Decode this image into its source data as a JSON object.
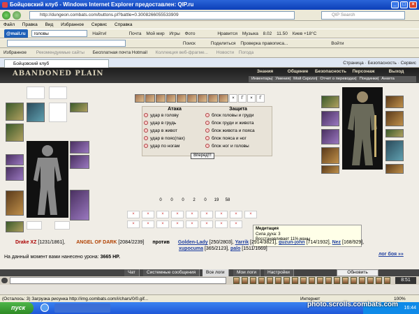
{
  "window": {
    "title": "Бойцовский клуб - Windows Internet Explorer предоставлен: QIP.ru",
    "min": "_",
    "max": "□",
    "close": "×"
  },
  "address": {
    "url": "http://dungeon.combats.com/buttons.pl?battle=0.3008266055533909",
    "search_placeholder": "QIP Search"
  },
  "menu": [
    "Файл",
    "Правка",
    "Вид",
    "Избранное",
    "Сервис",
    "Справка"
  ],
  "toolbar1": {
    "brand": "@mail.ru",
    "search_value": "головы",
    "find": "Найти!",
    "items": [
      "Почта",
      "Мой мир",
      "Игры",
      "Фото",
      "Нравится",
      "Музыка",
      "8.02",
      "11.50",
      "Киев +18°C"
    ]
  },
  "toolbar2": {
    "items": [
      "Поиск",
      "Поделиться",
      "Проверка правописа...",
      "Войти"
    ]
  },
  "favorites": {
    "label": "Избранное",
    "items": [
      "Рекомендуемые сайты",
      "Бесплатная почта Hotmail",
      "Коллекция веб-фрагме...",
      "Новости",
      "Погода"
    ]
  },
  "tab": {
    "label": "Бойцовский клуб",
    "tools": [
      "Страница",
      "Безопасность",
      "Сервис"
    ]
  },
  "game": {
    "title": "ABANDONED PLAIN",
    "nav_top": [
      "Знания",
      "Общение",
      "Безопасность",
      "Персонаж",
      "Выход"
    ],
    "nav_sub": [
      "Инвентарь",
      "Умения",
      "Мой Скролл",
      "Отчет о переводах",
      "Поединки",
      "Анкета"
    ],
    "stack_count": "x5",
    "attack": {
      "header": "Атака",
      "options": [
        "удар в голову",
        "удар в грудь",
        "удар в живот",
        "удар в пояс(пах)",
        "удар по ногам"
      ]
    },
    "defense": {
      "header": "Защита",
      "options": [
        "блок головы и груди",
        "блок груди и живота",
        "блок живота и пояса",
        "блок пояса и ног",
        "блок ног и головы"
      ]
    },
    "forward": "Вперед!!!",
    "hp_values": [
      "0",
      "0",
      "0",
      "2",
      "0",
      "19",
      "58"
    ],
    "tooltip": {
      "title": "Медитация",
      "line1": "Сила духа: 3",
      "line2": "Восстанавливает 11% маны"
    },
    "battle": {
      "player1": "Drake XZ",
      "player1_hp": "[1231/1861],",
      "player2": "ANGEL OF DARK",
      "player2_hp": "[2084/2239]",
      "versus": "против",
      "enemy1": "Golden-Lady",
      "enemy1_hp": "[250/2803],",
      "enemy2": "Yarrik",
      "enemy2_hp": "[2914/3821],",
      "enemy3": "guzun-john",
      "enemy3_hp": "[714/1932],",
      "enemy4": "Nez",
      "enemy4_hp": "[168/929],",
      "enemy5": "xupocuma",
      "enemy5_hp": "[365/2123],",
      "enemy6": "palo",
      "enemy6_hp": "[1511/1669]",
      "damage_text": "На данный момент вами нанесено урона:",
      "damage_value": "3665 HP.",
      "log_link": "лог боя »»"
    },
    "chat_tabs": [
      "Чат",
      "Системные сообщения",
      "Все логи",
      "Мои логи",
      "Настройки"
    ],
    "refresh": "Обновить",
    "time": "8:51"
  },
  "status": {
    "text": "(Осталось: 3) Загрузка рисунка http://img.combats.com/i/chars/0/0.gif...",
    "zone": "Интернет",
    "zoom": "100%"
  },
  "taskbar": {
    "start": "пуск",
    "clock": "16:44"
  },
  "watermark": "photo.scrolls.combats.com"
}
